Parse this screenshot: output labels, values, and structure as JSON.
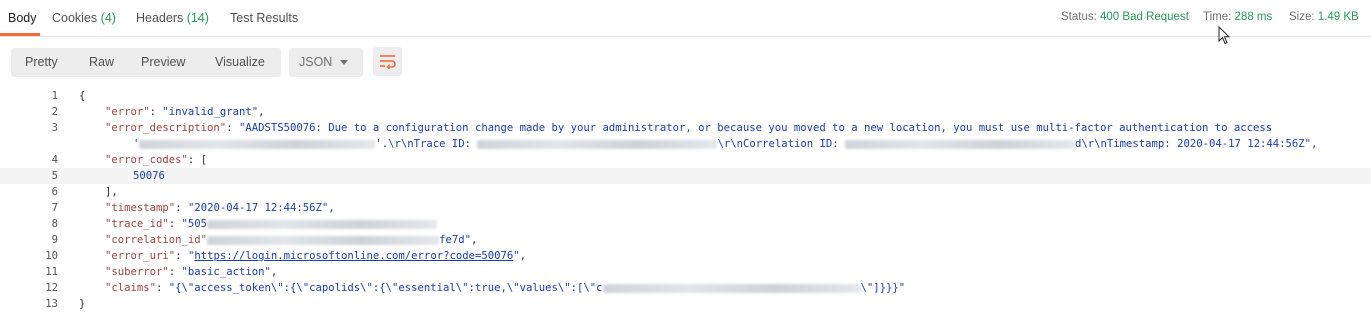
{
  "tabs": {
    "body": "Body",
    "cookies": "Cookies",
    "cookies_count": "(4)",
    "headers": "Headers",
    "headers_count": "(14)",
    "test_results": "Test Results"
  },
  "status_bar": {
    "status_label": "Status:",
    "status_value": "400 Bad Request",
    "time_label": "Time:",
    "time_value": "288 ms",
    "size_label": "Size:",
    "size_value": "1.49 KB"
  },
  "view_modes": {
    "pretty": "Pretty",
    "raw": "Raw",
    "preview": "Preview",
    "visualize": "Visualize"
  },
  "format_select": {
    "value": "JSON"
  },
  "colors": {
    "accent": "#f26b3a",
    "success": "#2a9a5b",
    "key": "#a04343",
    "string": "#1a3db0"
  },
  "icons": {
    "wrap": "wrap-lines-icon",
    "caret": "chevron-down-icon",
    "cursor": "mouse-pointer-icon"
  },
  "code": {
    "line_numbers": [
      "1",
      "2",
      "3",
      "4",
      "5",
      "6",
      "7",
      "8",
      "9",
      "10",
      "11",
      "12",
      "13"
    ],
    "l1": "{",
    "l2_key": "\"error\"",
    "l2_val": "\"invalid_grant\"",
    "l3_key": "\"error_description\"",
    "l3_val": "\"AADSTS50076: Due to a configuration change made by your administrator, or because you moved to a new location, you must use multi-factor authentication to access",
    "l3b_a": "'",
    "l3b_b": "'.\\r\\nTrace ID: ",
    "l3b_c": "\\r\\nCorrelation ID: ",
    "l3b_d": "d\\r\\nTimestamp: 2020-04-17 12:44:56Z\",",
    "l4_key": "\"error_codes\"",
    "l4_val": "[",
    "l5": "50076",
    "l6": "],",
    "l7_key": "\"timestamp\"",
    "l7_val": "\"2020-04-17 12:44:56Z\"",
    "l8_key": "\"trace_id\"",
    "l8_val": "\"505",
    "l9_key": "\"correlation_id\"",
    "l9_val": "fe7d\"",
    "l10_key": "\"error_uri\"",
    "l10_val_q1": "\"",
    "l10_val": "https://login.microsoftonline.com/error?code=50076",
    "l10_val_q2": "\"",
    "l11_key": "\"suberror\"",
    "l11_val": "\"basic_action\"",
    "l12_key": "\"claims\"",
    "l12_val_a": "\"{\\\"access_token\\\":{\\\"capolids\\\":{\\\"essential\\\":true,\\\"values\\\":[\\\"c",
    "l12_val_b": "\\\"]}}}\"",
    "l13": "}"
  }
}
